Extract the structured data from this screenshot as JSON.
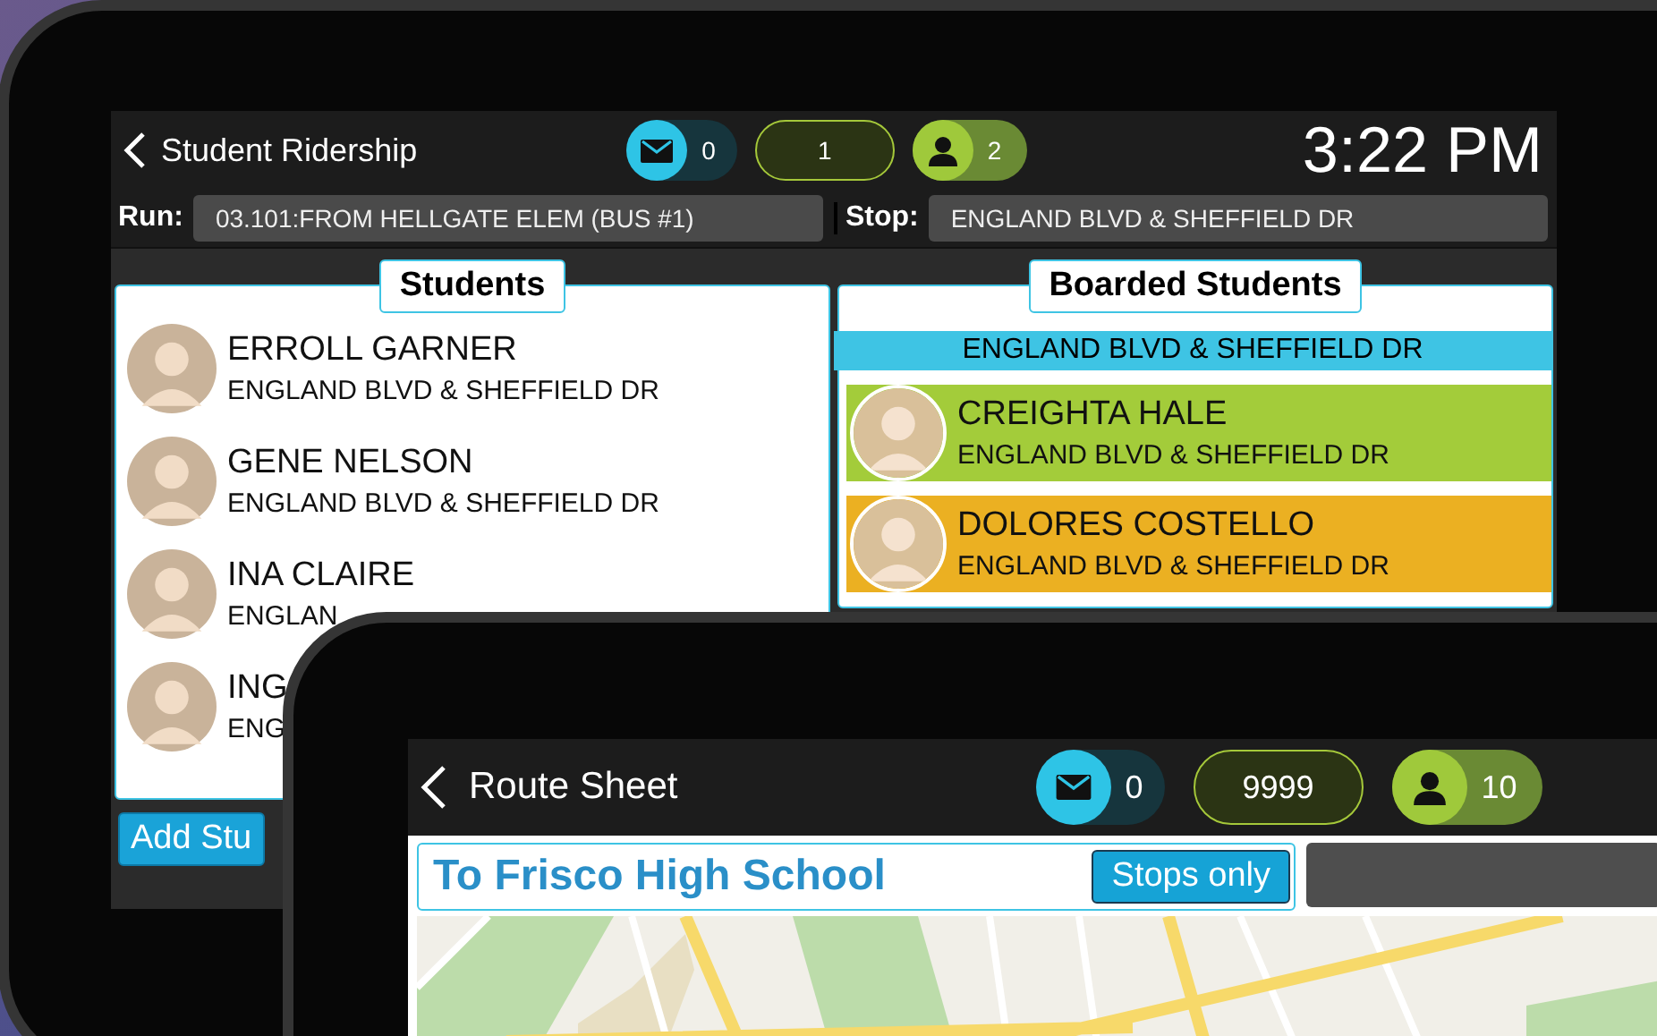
{
  "student_ridership": {
    "title": "Student Ridership",
    "messages": "0",
    "counter": "1",
    "riders": "2",
    "time": "3:22 PM",
    "run_label": "Run:",
    "run_value": "03.101:FROM HELLGATE ELEM (BUS #1)",
    "stop_label": "Stop:",
    "stop_value": "ENGLAND BLVD & SHEFFIELD DR",
    "students": {
      "title": "Students",
      "items": [
        {
          "name": "ERROLL GARNER",
          "stop": "ENGLAND BLVD & SHEFFIELD DR"
        },
        {
          "name": "GENE NELSON",
          "stop": "ENGLAND BLVD & SHEFFIELD DR"
        },
        {
          "name": "INA CLAIRE",
          "stop": "ENGLAN"
        },
        {
          "name": "ING",
          "stop": "ENG"
        }
      ]
    },
    "boarded": {
      "title": "Boarded Students",
      "stop_header": "ENGLAND BLVD & SHEFFIELD DR",
      "items": [
        {
          "name": "CREIGHTA HALE",
          "stop": "ENGLAND BLVD & SHEFFIELD DR",
          "color": "#a3cc3a"
        },
        {
          "name": "DOLORES COSTELLO",
          "stop": "ENGLAND BLVD & SHEFFIELD DR",
          "color": "#ebb022"
        }
      ]
    },
    "add_button": "Add Stu"
  },
  "route_sheet": {
    "title": "Route Sheet",
    "messages": "0",
    "counter": "9999",
    "riders": "10",
    "route": "To Frisco High School",
    "stops_only": "Stops only"
  }
}
